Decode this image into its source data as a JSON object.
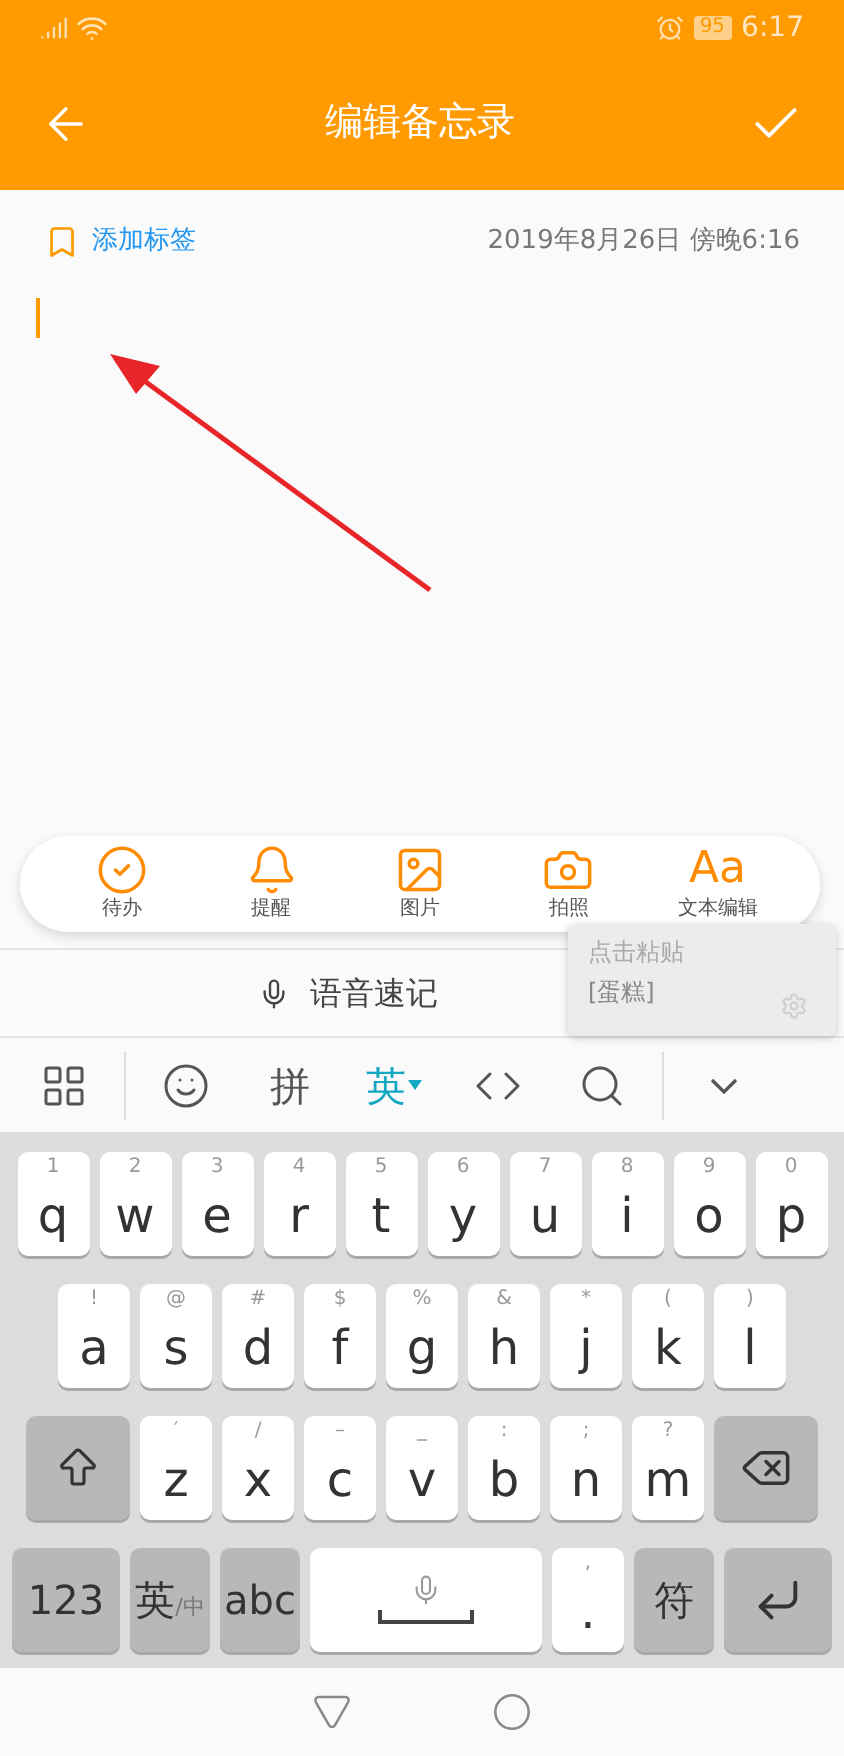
{
  "status_bar": {
    "battery": "95",
    "time": "6:17"
  },
  "header": {
    "title": "编辑备忘录"
  },
  "note": {
    "tag_button": "添加标签",
    "datetime": "2019年8月26日 傍晚6:16"
  },
  "toolbar": [
    {
      "kind": "todo",
      "label": "待办"
    },
    {
      "kind": "reminder",
      "label": "提醒"
    },
    {
      "kind": "image",
      "label": "图片"
    },
    {
      "kind": "camera",
      "label": "拍照"
    },
    {
      "kind": "text",
      "glyph": "Aa",
      "label": "文本编辑"
    }
  ],
  "paste_popup": {
    "title": "点击粘贴",
    "content": "[蛋糕]"
  },
  "voice_note": "语音速记",
  "ime_toolbar": [
    {
      "kind": "grid"
    },
    {
      "kind": "emoji"
    },
    {
      "kind": "label",
      "label": "拼",
      "selected": false
    },
    {
      "kind": "label",
      "label": "英",
      "selected": true
    },
    {
      "kind": "cursor"
    },
    {
      "kind": "search"
    },
    {
      "kind": "collapse"
    }
  ],
  "keyboard": [
    [
      {
        "kind": "letter",
        "label": "q",
        "hint": "1"
      },
      {
        "kind": "letter",
        "label": "w",
        "hint": "2"
      },
      {
        "kind": "letter",
        "label": "e",
        "hint": "3"
      },
      {
        "kind": "letter",
        "label": "r",
        "hint": "4"
      },
      {
        "kind": "letter",
        "label": "t",
        "hint": "5"
      },
      {
        "kind": "letter",
        "label": "y",
        "hint": "6"
      },
      {
        "kind": "letter",
        "label": "u",
        "hint": "7"
      },
      {
        "kind": "letter",
        "label": "i",
        "hint": "8"
      },
      {
        "kind": "letter",
        "label": "o",
        "hint": "9"
      },
      {
        "kind": "letter",
        "label": "p",
        "hint": "0"
      }
    ],
    [
      {
        "kind": "letter",
        "label": "a",
        "hint": "!"
      },
      {
        "kind": "letter",
        "label": "s",
        "hint": "@"
      },
      {
        "kind": "letter",
        "label": "d",
        "hint": "#"
      },
      {
        "kind": "letter",
        "label": "f",
        "hint": "$"
      },
      {
        "kind": "letter",
        "label": "g",
        "hint": "%"
      },
      {
        "kind": "letter",
        "label": "h",
        "hint": "&"
      },
      {
        "kind": "letter",
        "label": "j",
        "hint": "*"
      },
      {
        "kind": "letter",
        "label": "k",
        "hint": "("
      },
      {
        "kind": "letter",
        "label": "l",
        "hint": ")"
      }
    ],
    [
      {
        "kind": "shift"
      },
      {
        "kind": "letter",
        "label": "z",
        "hint": "′"
      },
      {
        "kind": "letter",
        "label": "x",
        "hint": "/"
      },
      {
        "kind": "letter",
        "label": "c",
        "hint": "–"
      },
      {
        "kind": "letter",
        "label": "v",
        "hint": "_"
      },
      {
        "kind": "letter",
        "label": "b",
        "hint": ":"
      },
      {
        "kind": "letter",
        "label": "n",
        "hint": ";"
      },
      {
        "kind": "letter",
        "label": "m",
        "hint": "?"
      },
      {
        "kind": "delete"
      }
    ],
    [
      {
        "kind": "fn",
        "label": "123"
      },
      {
        "kind": "fn",
        "label": "英",
        "sub": "/中"
      },
      {
        "kind": "fn",
        "label": "abc"
      },
      {
        "kind": "space"
      },
      {
        "kind": "letter",
        "label": ".",
        "hint": ","
      },
      {
        "kind": "fn",
        "label": "符"
      },
      {
        "kind": "enter"
      }
    ]
  ]
}
